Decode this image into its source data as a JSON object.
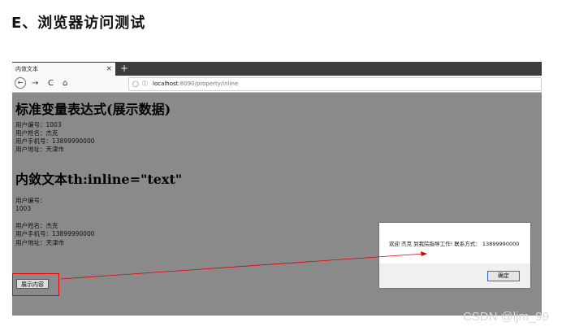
{
  "heading": "E、浏览器访问测试",
  "browser": {
    "tab_title": "内敛文本",
    "tab_close": "×",
    "new_tab": "+",
    "back": "←",
    "forward": "→",
    "reload": "C",
    "home": "⌂",
    "url_host": "localhost",
    "url_rest": ":8090/property/inline"
  },
  "page": {
    "section1_title": "标准变量表达式(展示数据)",
    "section1_lines": [
      "用户编号：1003",
      "用户姓名：杰克",
      "用户手机号：13899990000",
      "用户地址：天津市"
    ],
    "section2_title": "内敛文本th:inline=\"text\"",
    "section2_lines": [
      "用户编号：",
      "1003",
      "用户姓名：杰克",
      "用户手机号：13899990000",
      "用户地址：天津市"
    ],
    "show_button": "展示内容"
  },
  "dialog": {
    "message": "欢迎 杰克 到我院指导工作! 联系方式： 13899990000",
    "ok_button": "确定"
  },
  "watermark": "CSDN @ljm_99",
  "colors": {
    "page_bg": "#8a8a8a",
    "highlight": "#e00000",
    "tabbar": "#3c3c3c"
  }
}
